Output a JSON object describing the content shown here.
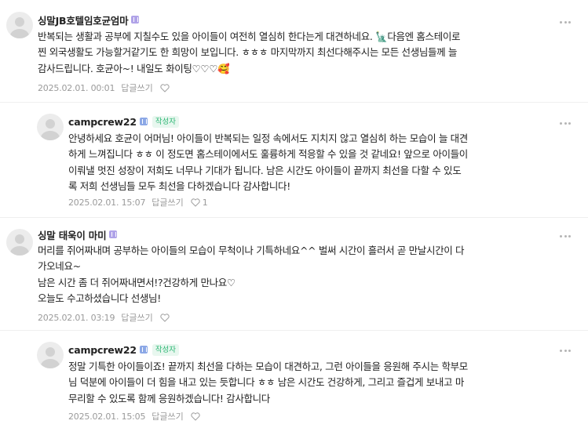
{
  "comments": [
    {
      "author": "싱말JB호텔임호균엄마",
      "content": "반복되는 생활과 공부에 지칠수도 있을 아이들이 여전히 열심히 한다는게 대견하네요. 🗽다음엔 홈스테이로\n찐 외국생활도 가능할거같기도 한 희망이 보입니다. ㅎㅎㅎ 마지막까지 최선다해주시는 모든 선생님들께 늘\n감사드립니다. 호균아~! 내일도 화이팅♡♡♡🥰",
      "date": "2025.02.01. 00:01",
      "reply_label": "답글쓰기",
      "likes": ""
    },
    {
      "author": "campcrew22",
      "badge": "작성자",
      "content": "안녕하세요 호균이 어머님! 아이들이 반복되는 일정 속에서도 지치지 않고 열심히 하는 모습이 늘 대견\n하게 느껴집니다 ㅎㅎ 이 정도면 홈스테이에서도 훌륭하게 적응할 수 있을 것 같네요! 앞으로 아이들이\n이뤄낼 멋진 성장이 저희도 너무나 기대가 됩니다. 남은 시간도 아이들이 끝까지 최선을 다할 수 있도\n록 저희 선생님들 모두 최선을 다하겠습니다 감사합니다!",
      "date": "2025.02.01. 15:07",
      "reply_label": "답글쓰기",
      "likes": "1"
    },
    {
      "author": "싱말 태욱이 마미",
      "content": "머리를 쥐어짜내며 공부하는 아이들의 모습이 무척이나 기특하네요^^ 벌써 시간이 흘러서 곧 만날시간이 다\n가오네요~\n남은 시간 좀 더 쥐어짜내면서!?건강하게 만나요♡\n오늘도 수고하셨습니다 선생님!",
      "date": "2025.02.01. 03:19",
      "reply_label": "답글쓰기",
      "likes": ""
    },
    {
      "author": "campcrew22",
      "badge": "작성자",
      "content": "정말 기특한 아이들이죠! 끝까지 최선을 다하는 모습이 대견하고, 그런 아이들을 응원해 주시는 학부모\n님 덕분에 아이들이 더 힘을 내고 있는 듯합니다 ㅎㅎ 남은 시간도 건강하게, 그리고 즐겁게 보내고 마\n무리할 수 있도록 함께 응원하겠습니다! 감사합니다",
      "date": "2025.02.01. 15:05",
      "reply_label": "답글쓰기",
      "likes": ""
    }
  ],
  "colors": {
    "grade_purple": "#b0a3e8",
    "grade_blue": "#8ca8e6",
    "writer_badge": "#2bb673"
  },
  "icons": {
    "more": "more-dots-icon",
    "heart": "heart-outline-icon",
    "avatar": "default-avatar-icon"
  }
}
